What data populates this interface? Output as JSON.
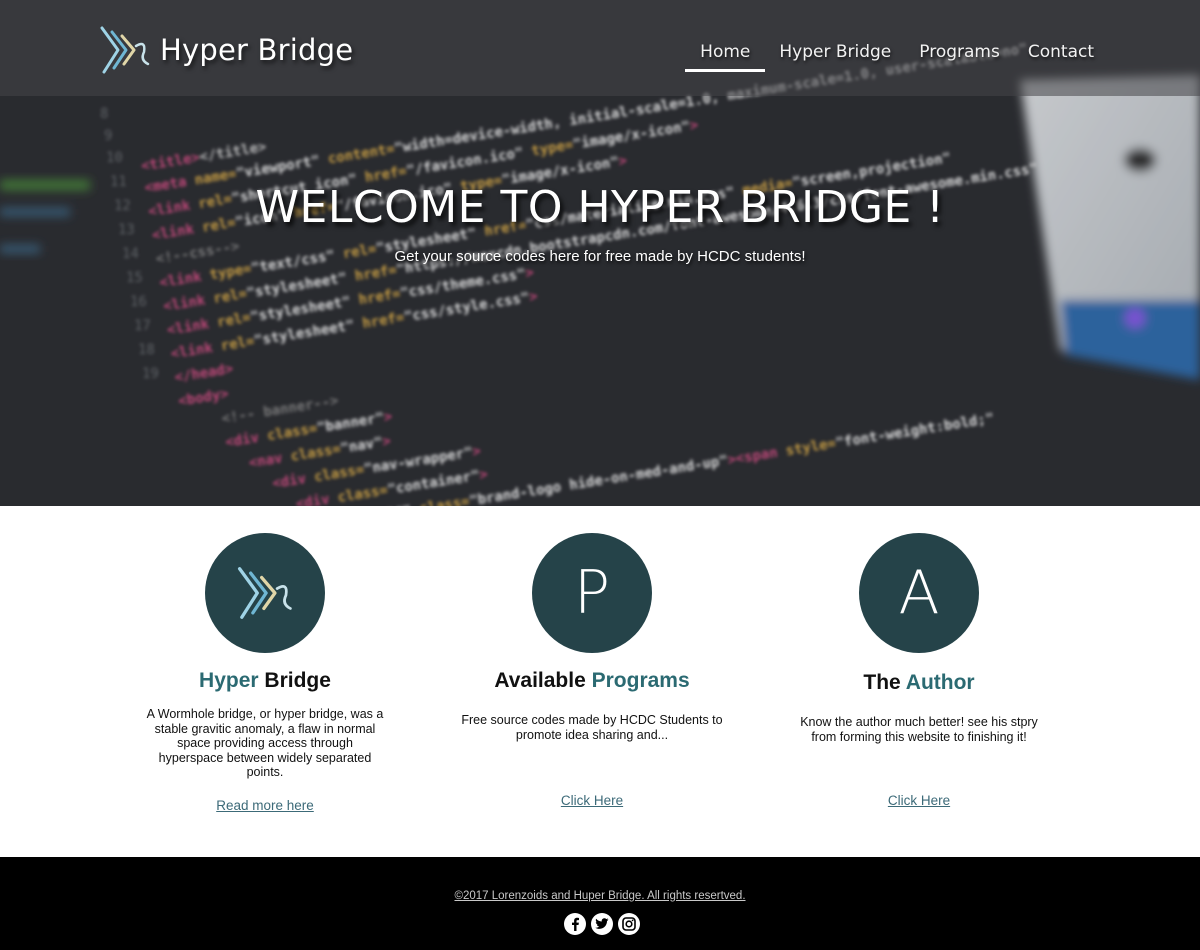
{
  "brand": {
    "name": "Hyper Bridge",
    "logo": "hyper-bridge-logo"
  },
  "nav": {
    "items": [
      {
        "label": "Home",
        "active": true
      },
      {
        "label": "Hyper Bridge",
        "active": false
      },
      {
        "label": "Programs",
        "active": false
      },
      {
        "label": "Contact",
        "active": false
      }
    ]
  },
  "hero": {
    "title": "WELCOME TO HYPER BRIDGE !",
    "subtitle": "Get your source codes here for free made by HCDC students!",
    "background": "blurred-html-source-code"
  },
  "features": [
    {
      "icon": "hyper-bridge-logo",
      "heading_highlight": "Hyper",
      "heading_rest": "Bridge",
      "text": "A Wormhole bridge, or hyper bridge, was a stable gravitic anomaly,  a flaw in normal space providing access through hyperspace between widely separated points.",
      "link": "Read more here"
    },
    {
      "icon_letter": "P",
      "heading_dark": "Available",
      "heading_highlight": "Programs",
      "text": "Free source codes made by HCDC Students to promote idea sharing and...",
      "link": "Click Here"
    },
    {
      "icon_letter": "A",
      "heading_dark": "The",
      "heading_highlight": "Author",
      "text": "Know the author much better! see his stpry from forming this website to finishing it!",
      "link": "Click Here"
    }
  ],
  "footer": {
    "copyright": "©2017 Lorenzoids and Huper Bridge. All rights resertved.",
    "socials": [
      "facebook-icon",
      "twitter-icon",
      "instagram-icon"
    ]
  },
  "colors": {
    "accent": "#2b6a72",
    "circle": "#254349",
    "link": "#3c6a78",
    "footer": "#000000"
  }
}
